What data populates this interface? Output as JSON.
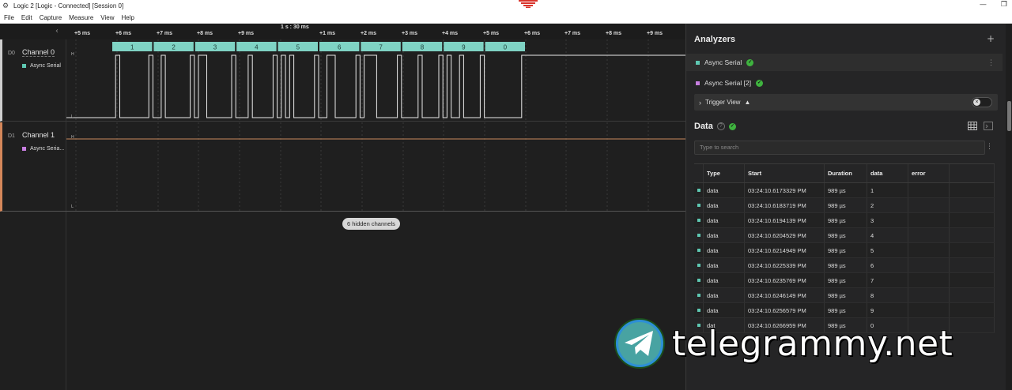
{
  "window": {
    "title": "Logic 2 [Logic - Connected] [Session 0]",
    "minimize_icon": "minimize-icon",
    "restore_icon": "restore-icon"
  },
  "menu": [
    "File",
    "Edit",
    "Capture",
    "Measure",
    "View",
    "Help"
  ],
  "ruler": {
    "center_time": "1 s : 30 ms",
    "ticks": [
      "+5 ms",
      "+6 ms",
      "+7 ms",
      "+8 ms",
      "+9 ms",
      "+1 ms",
      "+2 ms",
      "+3 ms",
      "+4 ms",
      "+5 ms",
      "+6 ms",
      "+7 ms",
      "+8 ms",
      "+9 ms"
    ]
  },
  "channels": [
    {
      "id": "D0",
      "name": "Channel 0",
      "analyzer": "Async Serial",
      "color": "#5ec8b2"
    },
    {
      "id": "D1",
      "name": "Channel 1",
      "analyzer": "Async Seria...",
      "color": "#c77ee0"
    }
  ],
  "level_labels": {
    "high": "H",
    "low": "L"
  },
  "decoded_bytes": [
    "1",
    "2",
    "3",
    "4",
    "5",
    "6",
    "7",
    "8",
    "9",
    "0"
  ],
  "hidden_channels": "6 hidden channels",
  "analyzers_panel": {
    "title": "Analyzers",
    "add_icon": "plus-icon",
    "items": [
      {
        "name": "Async Serial",
        "color": "#5ec8b2",
        "selected": true
      },
      {
        "name": "Async Serial [2]",
        "color": "#c77ee0",
        "selected": false
      }
    ],
    "trigger_view": "Trigger View",
    "trigger_enabled": false
  },
  "data_panel": {
    "title": "Data",
    "help": "?",
    "search_placeholder": "Type to search",
    "columns": [
      "Type",
      "Start",
      "Duration",
      "data",
      "error"
    ],
    "rows": [
      {
        "type": "data",
        "start": "03:24:10.6173329 PM",
        "duration": "989 µs",
        "data": "1",
        "error": ""
      },
      {
        "type": "data",
        "start": "03:24:10.6183719 PM",
        "duration": "989 µs",
        "data": "2",
        "error": ""
      },
      {
        "type": "data",
        "start": "03:24:10.6194139 PM",
        "duration": "989 µs",
        "data": "3",
        "error": ""
      },
      {
        "type": "data",
        "start": "03:24:10.6204529 PM",
        "duration": "989 µs",
        "data": "4",
        "error": ""
      },
      {
        "type": "data",
        "start": "03:24:10.6214949 PM",
        "duration": "989 µs",
        "data": "5",
        "error": ""
      },
      {
        "type": "data",
        "start": "03:24:10.6225339 PM",
        "duration": "989 µs",
        "data": "6",
        "error": ""
      },
      {
        "type": "data",
        "start": "03:24:10.6235769 PM",
        "duration": "989 µs",
        "data": "7",
        "error": ""
      },
      {
        "type": "data",
        "start": "03:24:10.6246149 PM",
        "duration": "989 µs",
        "data": "8",
        "error": ""
      },
      {
        "type": "data",
        "start": "03:24:10.6256579 PM",
        "duration": "989 µs",
        "data": "9",
        "error": ""
      },
      {
        "type": "dat",
        "start": "03:24:10.6266959 PM",
        "duration": "989 µs",
        "data": "0",
        "error": ""
      }
    ]
  },
  "watermark": "telegrammy.net",
  "colors": {
    "accent_green": "#3fb33f",
    "decode_bubble": "#7fd3c4",
    "channel1_trace": "#c98a5c",
    "logo_red": "#d9332b"
  }
}
